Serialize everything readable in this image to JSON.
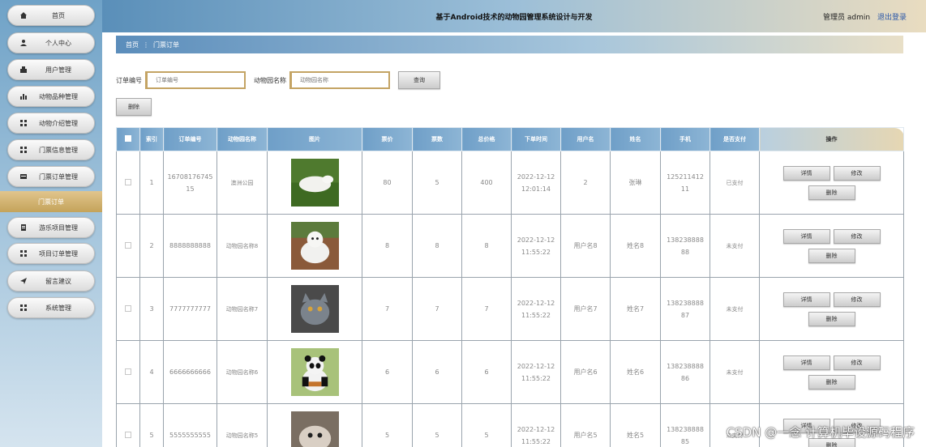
{
  "app": {
    "title": "基于Android技术的动物园管理系统设计与开发",
    "user": "管理员 admin",
    "logout": "退出登录"
  },
  "sidebar": {
    "items": [
      {
        "label": "首页",
        "icon": "home-icon"
      },
      {
        "label": "个人中心",
        "icon": "person-icon"
      },
      {
        "label": "用户管理",
        "icon": "users-icon"
      },
      {
        "label": "动物品种管理",
        "icon": "bar-chart-icon"
      },
      {
        "label": "动物介绍管理",
        "icon": "grid-icon"
      },
      {
        "label": "门票信息管理",
        "icon": "grid-icon"
      },
      {
        "label": "门票订单管理",
        "icon": "ticket-icon"
      }
    ],
    "active_sub": "门票订单",
    "items2": [
      {
        "label": "游乐项目管理",
        "icon": "document-icon"
      },
      {
        "label": "项目订单管理",
        "icon": "grid-icon"
      },
      {
        "label": "留言建议",
        "icon": "send-icon"
      },
      {
        "label": "系统管理",
        "icon": "grid-icon"
      }
    ]
  },
  "breadcrumb": {
    "home": "首页",
    "sep": "⋮",
    "current": "门票订单"
  },
  "search": {
    "order_label": "订单编号",
    "order_placeholder": "订单编号",
    "zoo_label": "动物园名称",
    "zoo_placeholder": "动物园名称",
    "query_button": "查询",
    "delete_button": "删除"
  },
  "table": {
    "columns": [
      "索引",
      "订单编号",
      "动物园名称",
      "图片",
      "票价",
      "票数",
      "总价格",
      "下单时间",
      "用户名",
      "姓名",
      "手机",
      "是否支付",
      "操作"
    ],
    "buttons": {
      "detail": "详情",
      "edit": "修改",
      "delete": "删除"
    },
    "rows": [
      {
        "index": "1",
        "order_no": "1670817674515",
        "zoo": "澳洲公园",
        "price": "80",
        "count": "5",
        "total": "400",
        "time_date": "2022-12-12",
        "time_clock": "12:01:14",
        "username": "2",
        "name": "张琳",
        "phone": "12521141211",
        "paid": "已支付",
        "photo": "white-bird"
      },
      {
        "index": "2",
        "order_no": "8888888888",
        "zoo": "动物园名称8",
        "price": "8",
        "count": "8",
        "total": "8",
        "time_date": "2022-12-12",
        "time_clock": "11:55:22",
        "username": "用户名8",
        "name": "姓名8",
        "phone": "13823888888",
        "paid": "未支付",
        "photo": "white-fox"
      },
      {
        "index": "3",
        "order_no": "7777777777",
        "zoo": "动物园名称7",
        "price": "7",
        "count": "7",
        "total": "7",
        "time_date": "2022-12-12",
        "time_clock": "11:55:22",
        "username": "用户名7",
        "name": "姓名7",
        "phone": "13823888887",
        "paid": "未支付",
        "photo": "grey-cat"
      },
      {
        "index": "4",
        "order_no": "6666666666",
        "zoo": "动物园名称6",
        "price": "6",
        "count": "6",
        "total": "6",
        "time_date": "2022-12-12",
        "time_clock": "11:55:22",
        "username": "用户名6",
        "name": "姓名6",
        "phone": "13823888886",
        "paid": "未支付",
        "photo": "panda"
      },
      {
        "index": "5",
        "order_no": "5555555555",
        "zoo": "动物园名称5",
        "price": "5",
        "count": "5",
        "total": "5",
        "time_date": "2022-12-12",
        "time_clock": "11:55:22",
        "username": "用户名5",
        "name": "姓名5",
        "phone": "13823888885",
        "paid": "未支付",
        "photo": "dog"
      }
    ]
  },
  "watermark": "CSDN @一念 计算机毕设源码程序",
  "colors": {
    "accent_gold": "#c4a464",
    "header_blue": "#5a8fb9",
    "active_nav": "#d7b772"
  }
}
